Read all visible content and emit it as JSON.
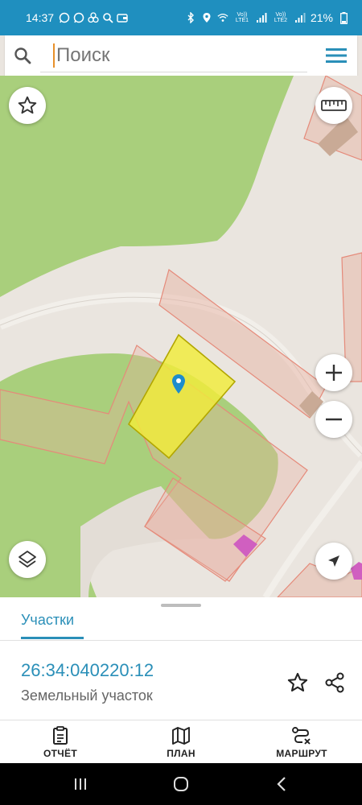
{
  "status_bar": {
    "time": "14:37",
    "network_1": "Vo)) LTE1",
    "network_2": "Vo)) LTE2",
    "battery": "21%"
  },
  "search": {
    "placeholder": "Поиск",
    "value": ""
  },
  "bottom_sheet": {
    "tab_label": "Участки",
    "parcel_number": "26:34:040220:12",
    "parcel_type": "Земельный участок"
  },
  "bottom_nav": {
    "report_label": "ОТЧЁТ",
    "plan_label": "ПЛАН",
    "route_label": "МАРШРУТ"
  },
  "colors": {
    "accent": "#2a8fb8",
    "status_bar": "#1f8fbf",
    "selected_parcel": "#f2ec3a",
    "parcel_outline": "#e58a7a",
    "green_area": "#a9cf7c"
  },
  "icons": {
    "search": "search-icon",
    "menu": "menu-icon",
    "favorite": "star-icon",
    "ruler": "ruler-icon",
    "zoom_in": "plus-icon",
    "zoom_out": "minus-icon",
    "layers": "layers-icon",
    "location": "navigation-arrow-icon",
    "share": "share-icon",
    "report": "clipboard-icon",
    "plan": "map-icon",
    "route": "route-icon"
  }
}
